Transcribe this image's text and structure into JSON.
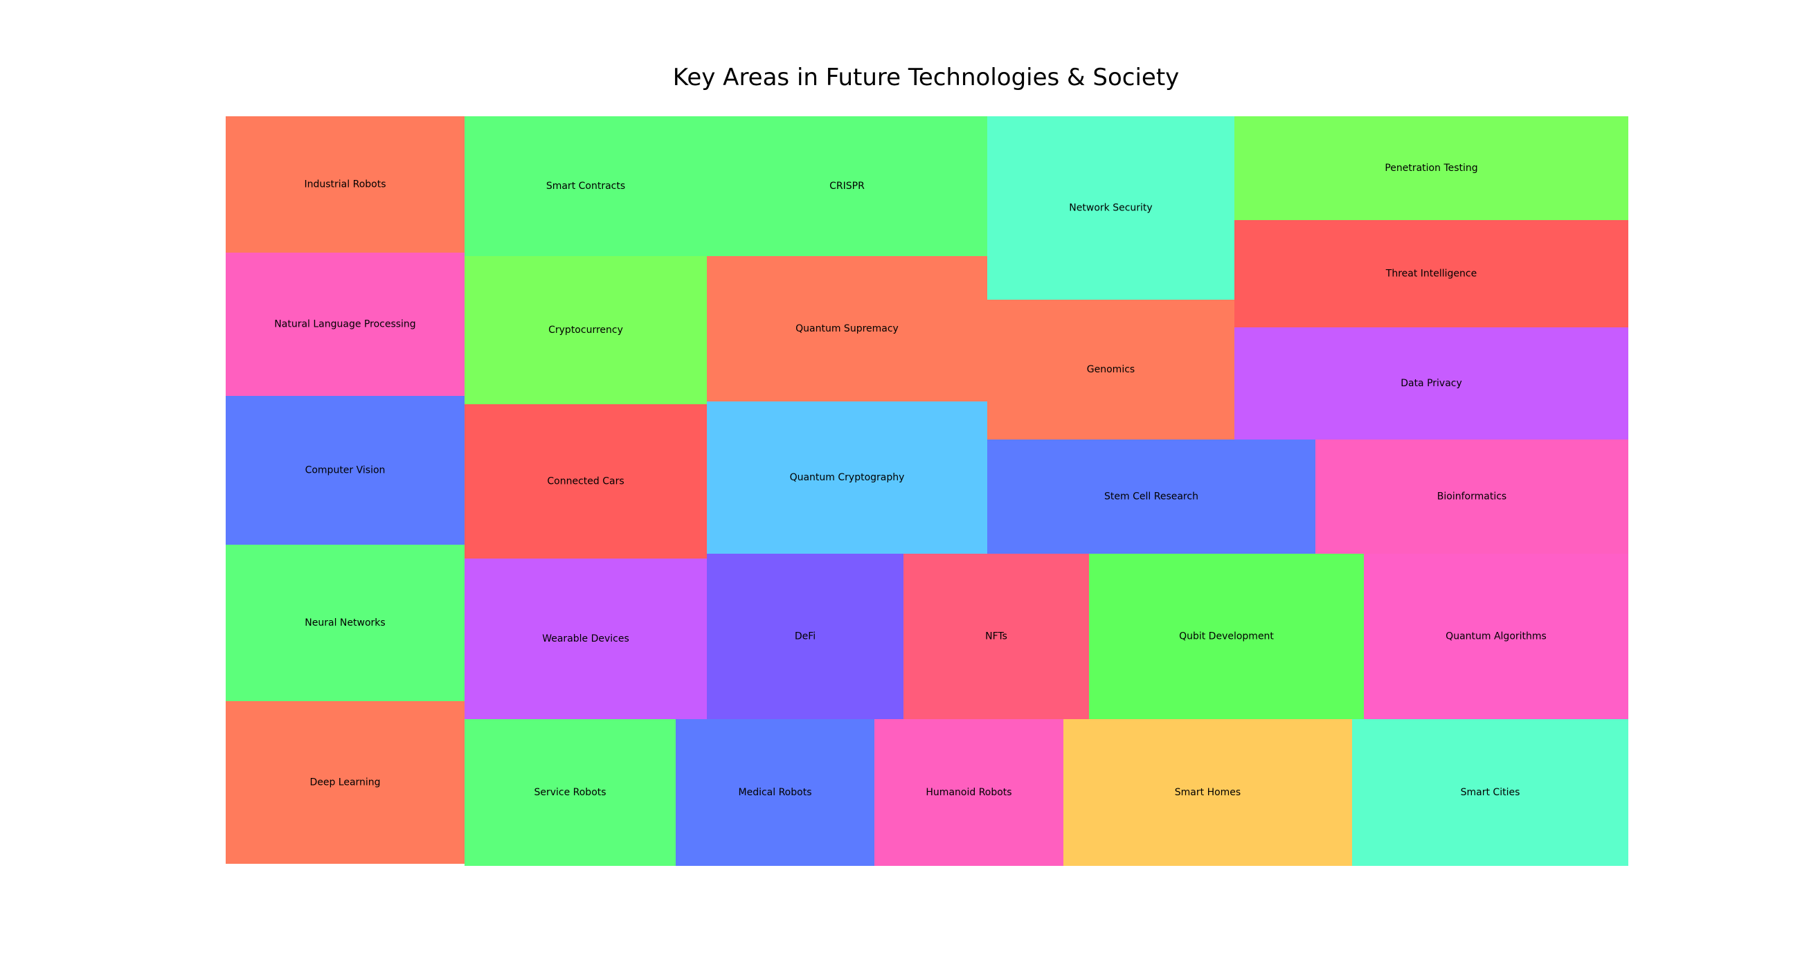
{
  "chart_data": {
    "type": "treemap",
    "title": "Key Areas in Future Technologies & Society",
    "items": [
      {
        "label": "Industrial Robots",
        "value": 23,
        "color": "#ff7b5c"
      },
      {
        "label": "Natural Language Processing",
        "value": 25,
        "color": "#ff5fbf"
      },
      {
        "label": "Computer Vision",
        "value": 26,
        "color": "#5c7bff"
      },
      {
        "label": "Neural Networks",
        "value": 27,
        "color": "#5cff7b"
      },
      {
        "label": "Deep Learning",
        "value": 28,
        "color": "#ff7b5c"
      },
      {
        "label": "Smart Contracts",
        "value": 25,
        "color": "#5cff7b"
      },
      {
        "label": "CRISPR",
        "value": 29,
        "color": "#5cff7b"
      },
      {
        "label": "Network Security",
        "value": 34,
        "color": "#5cffcb"
      },
      {
        "label": "Penetration Testing",
        "value": 30,
        "color": "#7bff5c"
      },
      {
        "label": "Cryptocurrency",
        "value": 27,
        "color": "#7bff5c"
      },
      {
        "label": "Quantum Supremacy",
        "value": 30,
        "color": "#ff7b5c"
      },
      {
        "label": "Threat Intelligence",
        "value": 31,
        "color": "#ff5c5c"
      },
      {
        "label": "Genomics",
        "value": 25,
        "color": "#ff7b5c"
      },
      {
        "label": "Data Privacy",
        "value": 33,
        "color": "#c75cff"
      },
      {
        "label": "Connected Cars",
        "value": 28,
        "color": "#ff5c5c"
      },
      {
        "label": "Quantum Cryptography",
        "value": 32,
        "color": "#5cc7ff"
      },
      {
        "label": "Stem Cell Research",
        "value": 28,
        "color": "#5c7bff"
      },
      {
        "label": "Bioinformatics",
        "value": 27,
        "color": "#ff5fbf"
      },
      {
        "label": "Wearable Devices",
        "value": 29,
        "color": "#c75cff"
      },
      {
        "label": "DeFi",
        "value": 24,
        "color": "#7b5cff"
      },
      {
        "label": "NFTs",
        "value": 23,
        "color": "#ff5c7b"
      },
      {
        "label": "Qubit Development",
        "value": 34,
        "color": "#5fff5c"
      },
      {
        "label": "Quantum Algorithms",
        "value": 33,
        "color": "#ff5fc7"
      },
      {
        "label": "Service Robots",
        "value": 23,
        "color": "#5cff7b"
      },
      {
        "label": "Medical Robots",
        "value": 22,
        "color": "#5c7bff"
      },
      {
        "label": "Humanoid Robots",
        "value": 21,
        "color": "#ff5fbf"
      },
      {
        "label": "Smart Homes",
        "value": 32,
        "color": "#ffcb5c"
      },
      {
        "label": "Smart Cities",
        "value": 31,
        "color": "#5cffcb"
      }
    ]
  }
}
